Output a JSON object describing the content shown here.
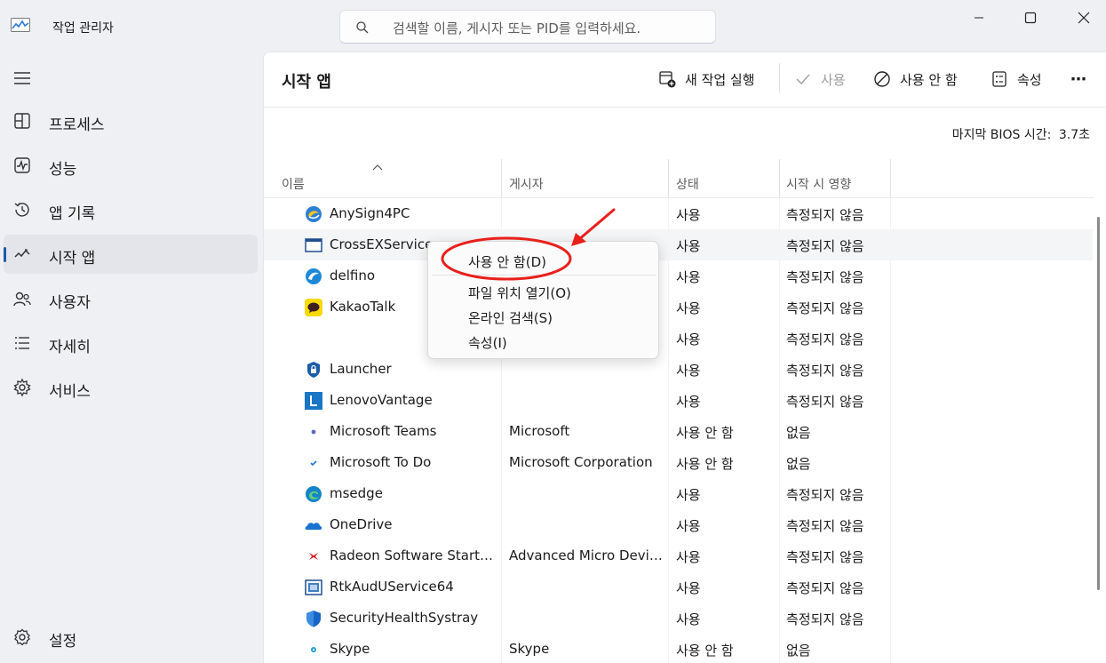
{
  "app": {
    "title": "작업 관리자"
  },
  "search": {
    "placeholder": "검색할 이름, 게시자 또는 PID를 입력하세요."
  },
  "sidebar": {
    "items": [
      {
        "label": "프로세스",
        "icon": "processes-icon"
      },
      {
        "label": "성능",
        "icon": "performance-icon"
      },
      {
        "label": "앱 기록",
        "icon": "app-history-icon"
      },
      {
        "label": "시작 앱",
        "icon": "startup-apps-icon",
        "active": true
      },
      {
        "label": "사용자",
        "icon": "users-icon"
      },
      {
        "label": "자세히",
        "icon": "details-icon"
      },
      {
        "label": "서비스",
        "icon": "services-icon"
      }
    ],
    "settings_label": "설정"
  },
  "page": {
    "title": "시작 앱"
  },
  "toolbar": {
    "run_new_task": "새 작업 실행",
    "enable": "사용",
    "disable": "사용 안 함",
    "properties": "속성",
    "more": "⋯"
  },
  "bios": {
    "label": "마지막 BIOS 시간:",
    "value": "3.7초"
  },
  "table": {
    "columns": {
      "name": "이름",
      "publisher": "게시자",
      "status": "상태",
      "impact": "시작 시 영향"
    },
    "rows": [
      {
        "name": "AnySign4PC",
        "publisher": "",
        "status": "사용",
        "impact": "측정되지 않음",
        "icon": "anysign-icon"
      },
      {
        "name": "CrossEXService",
        "publisher": "",
        "status": "사용",
        "impact": "측정되지 않음",
        "icon": "window-app-icon"
      },
      {
        "name": "delfino",
        "publisher": "",
        "status": "사용",
        "impact": "측정되지 않음",
        "icon": "delfino-icon"
      },
      {
        "name": "KakaoTalk",
        "publisher": "",
        "status": "사용",
        "impact": "측정되지 않음",
        "icon": "kakaotalk-icon"
      },
      {
        "name": "",
        "publisher": "",
        "status": "사용",
        "impact": "측정되지 않음",
        "icon": ""
      },
      {
        "name": "Launcher",
        "publisher": "",
        "status": "사용",
        "impact": "측정되지 않음",
        "icon": "launcher-icon"
      },
      {
        "name": "LenovoVantage",
        "publisher": "",
        "status": "사용",
        "impact": "측정되지 않음",
        "icon": "lenovo-icon"
      },
      {
        "name": "Microsoft Teams",
        "publisher": "Microsoft",
        "status": "사용 안 함",
        "impact": "없음",
        "icon": "teams-icon"
      },
      {
        "name": "Microsoft To Do",
        "publisher": "Microsoft Corporation",
        "status": "사용 안 함",
        "impact": "없음",
        "icon": "todo-icon"
      },
      {
        "name": "msedge",
        "publisher": "",
        "status": "사용",
        "impact": "측정되지 않음",
        "icon": "edge-icon"
      },
      {
        "name": "OneDrive",
        "publisher": "",
        "status": "사용",
        "impact": "측정되지 않음",
        "icon": "onedrive-icon"
      },
      {
        "name": "Radeon Software Startup ...",
        "publisher": "Advanced Micro Device...",
        "status": "사용",
        "impact": "측정되지 않음",
        "icon": "radeon-icon"
      },
      {
        "name": "RtkAudUService64",
        "publisher": "",
        "status": "사용",
        "impact": "측정되지 않음",
        "icon": "realtek-icon"
      },
      {
        "name": "SecurityHealthSystray",
        "publisher": "",
        "status": "사용",
        "impact": "측정되지 않음",
        "icon": "shield-icon"
      },
      {
        "name": "Skype",
        "publisher": "Skype",
        "status": "사용 안 함",
        "impact": "없음",
        "icon": "skype-icon"
      }
    ]
  },
  "context_menu": {
    "items": [
      "사용 안 함(D)",
      "파일 위치 열기(O)",
      "온라인 검색(S)",
      "속성(I)"
    ]
  },
  "colors": {
    "accent": "#1c5aa8",
    "annotation": "#e8201b"
  }
}
